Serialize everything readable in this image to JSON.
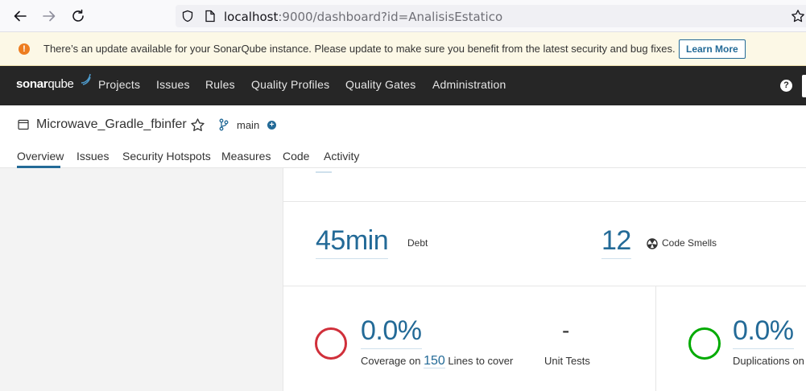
{
  "browser": {
    "url_host": "localhost",
    "url_rest": ":9000/dashboard?id=AnalisisEstatico"
  },
  "banner": {
    "text": "There’s an update available for your SonarQube instance. Please update to make sure you benefit from the latest security and bug fixes.",
    "button": "Learn More"
  },
  "topnav": {
    "logo_a": "sonar",
    "logo_b": "qube",
    "items": [
      "Projects",
      "Issues",
      "Rules",
      "Quality Profiles",
      "Quality Gates",
      "Administration"
    ],
    "help": "?"
  },
  "project": {
    "name": "Microwave_Gradle_fbinfer",
    "branch": "main",
    "add": "+",
    "tabs": [
      "Overview",
      "Issues",
      "Security Hotspots",
      "Measures",
      "Code",
      "Activity"
    ]
  },
  "metrics": {
    "debt_value": "45min",
    "debt_label": "Debt",
    "smells_value": "12",
    "smells_label": "Code Smells",
    "coverage_value": "0.0%",
    "coverage_prefix": "Coverage on",
    "coverage_lines": "150",
    "coverage_suffix": "Lines to cover",
    "unit_tests_value": "-",
    "unit_tests_label": "Unit Tests",
    "duplications_value": "0.0%",
    "duplications_label": "Duplications on"
  },
  "colors": {
    "accent": "#236a97",
    "coverage_ring": "#d02f3a",
    "duplication_ring": "#00aa00",
    "nav_bg": "#262626",
    "banner_bg": "#fcf8e6"
  }
}
